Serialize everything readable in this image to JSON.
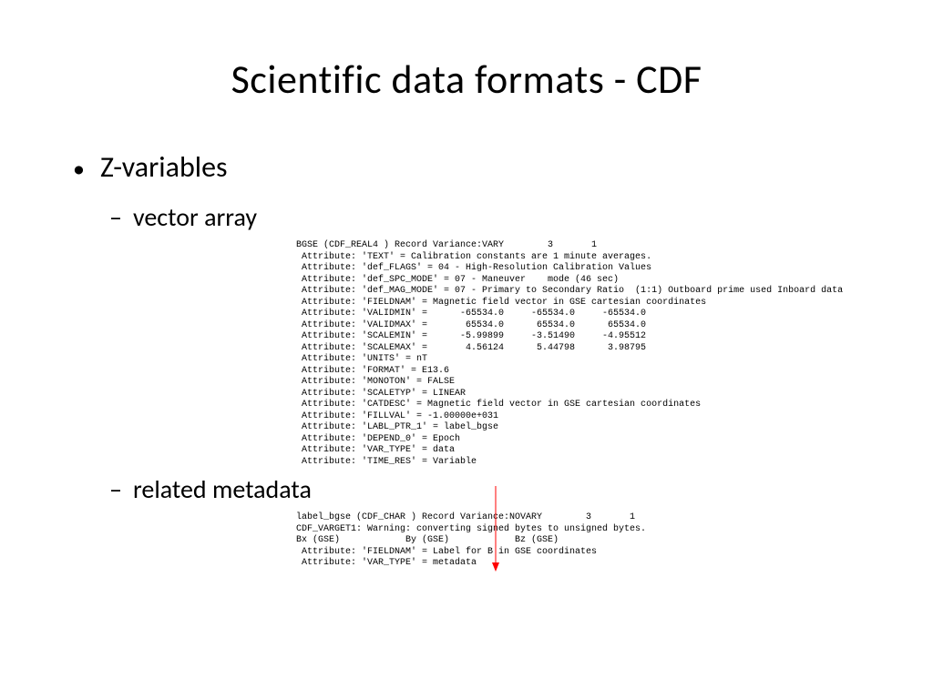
{
  "title": "Scientific data formats - CDF",
  "bullets": {
    "l1": "Z-variables",
    "l2a": "vector array",
    "l2b": "related metadata"
  },
  "code": {
    "block1": "BGSE (CDF_REAL4 ) Record Variance:VARY        3       1\n Attribute: 'TEXT' = Calibration constants are 1 minute averages.\n Attribute: 'def_FLAGS' = 04 - High-Resolution Calibration Values\n Attribute: 'def_SPC_MODE' = 07 - Maneuver    mode (46 sec)\n Attribute: 'def_MAG_MODE' = 07 - Primary to Secondary Ratio  (1:1) Outboard prime used Inboard data\n Attribute: 'FIELDNAM' = Magnetic field vector in GSE cartesian coordinates\n Attribute: 'VALIDMIN' =      -65534.0     -65534.0     -65534.0\n Attribute: 'VALIDMAX' =       65534.0      65534.0      65534.0\n Attribute: 'SCALEMIN' =      -5.99899     -3.51490     -4.95512\n Attribute: 'SCALEMAX' =       4.56124      5.44798      3.98795\n Attribute: 'UNITS' = nT\n Attribute: 'FORMAT' = E13.6\n Attribute: 'MONOTON' = FALSE\n Attribute: 'SCALETYP' = LINEAR\n Attribute: 'CATDESC' = Magnetic field vector in GSE cartesian coordinates\n Attribute: 'FILLVAL' = -1.00000e+031\n Attribute: 'LABL_PTR_1' = label_bgse\n Attribute: 'DEPEND_0' = Epoch\n Attribute: 'VAR_TYPE' = data\n Attribute: 'TIME_RES' = Variable",
    "block2": "label_bgse (CDF_CHAR ) Record Variance:NOVARY        3       1\nCDF_VARGET1: Warning: converting signed bytes to unsigned bytes.\nBx (GSE)            By (GSE)            Bz (GSE)\n Attribute: 'FIELDNAM' = Label for B in GSE coordinates\n Attribute: 'VAR_TYPE' = metadata"
  }
}
